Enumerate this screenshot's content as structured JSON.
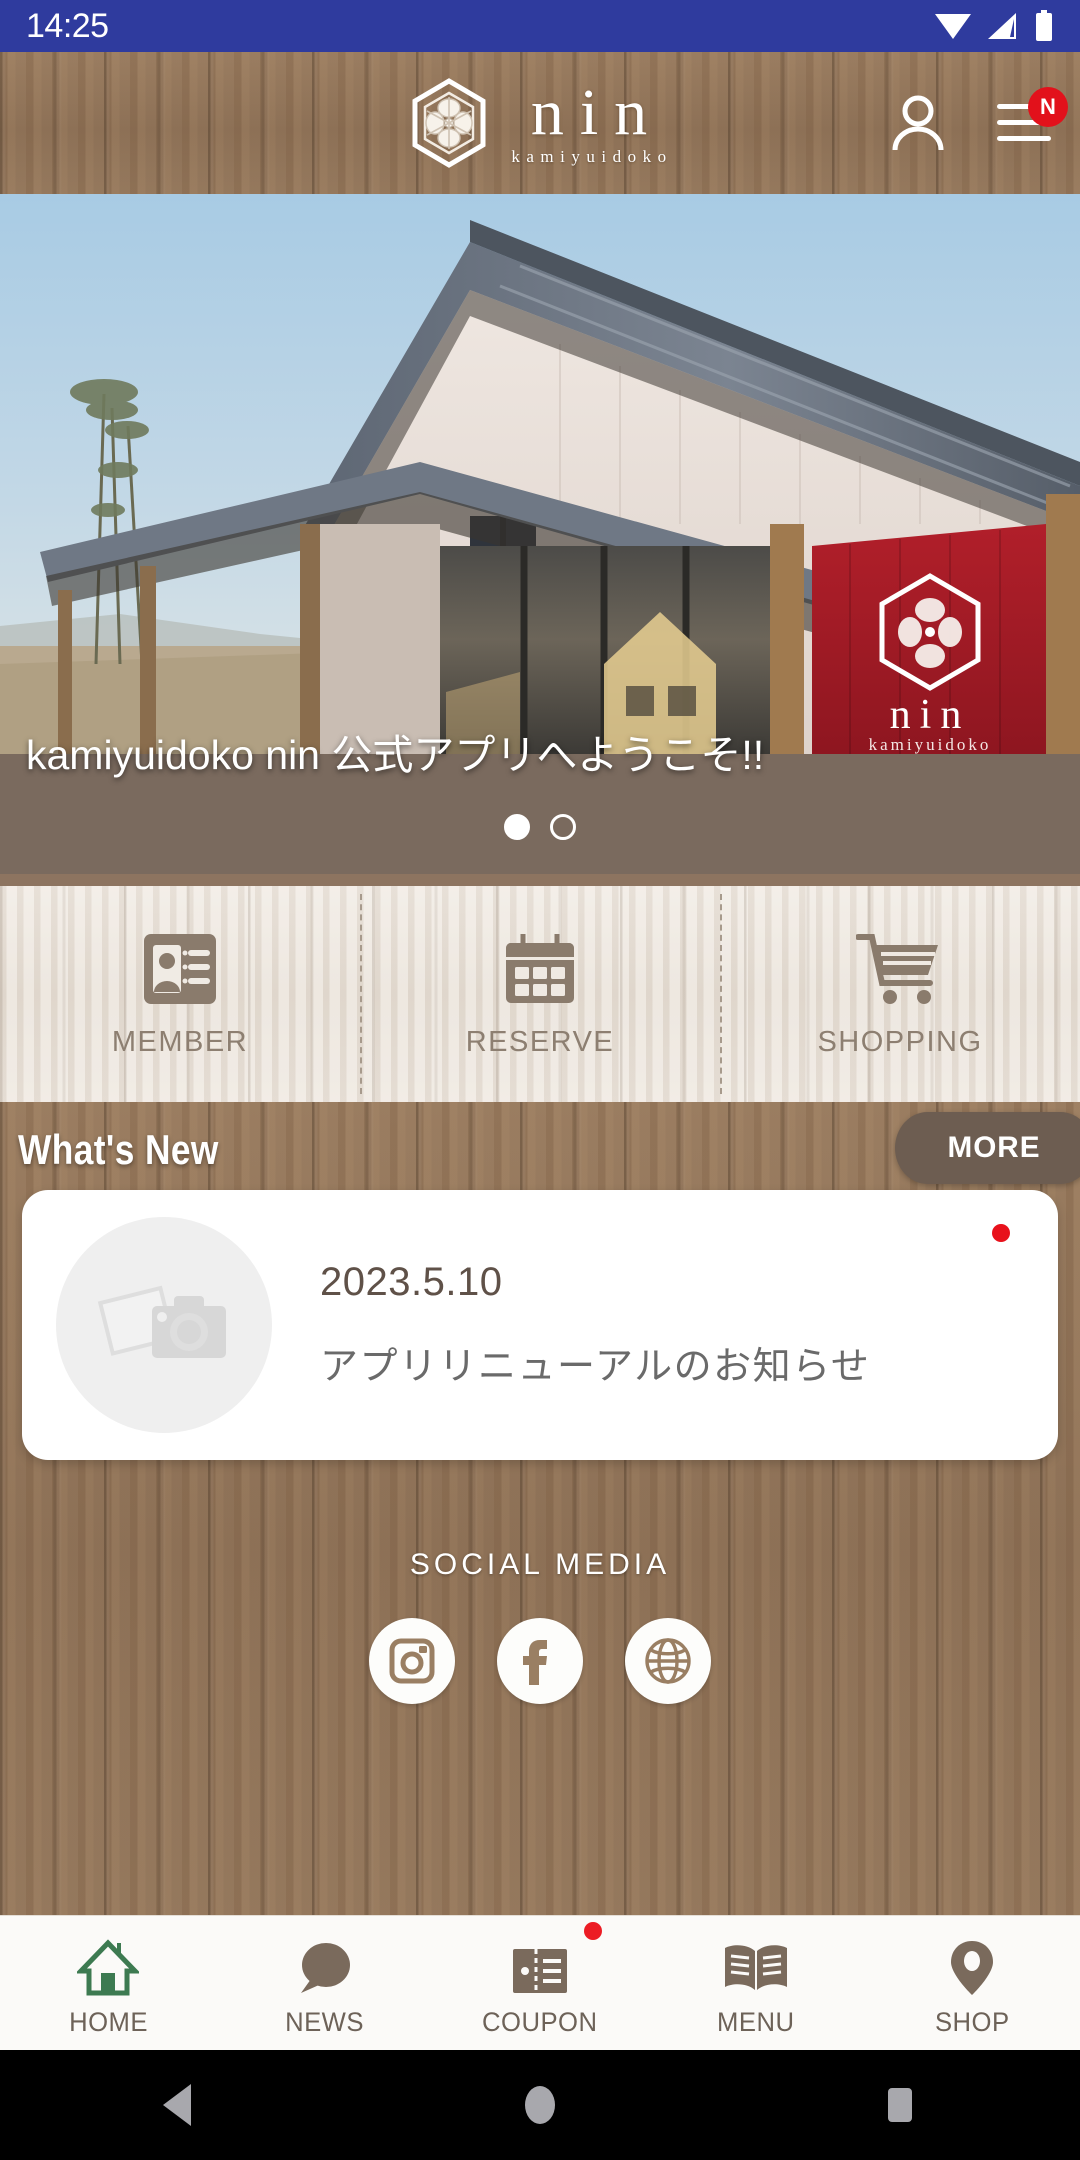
{
  "status_bar": {
    "time": "14:25",
    "icons": [
      "wifi-icon",
      "cellular-signal-icon",
      "battery-icon"
    ]
  },
  "header": {
    "logo_word": "nin",
    "logo_sub": "kamiyuidoko",
    "logo_mark_icon": "hexagon-blossom-logo-icon",
    "account_icon": "person-icon",
    "menu_icon": "hamburger-menu-icon",
    "menu_badge": "N",
    "badge_color": "#e2111b"
  },
  "hero": {
    "caption": "kamiyuidoko nin 公式アプリへようこそ!!",
    "slide_count": 2,
    "active_slide": 1,
    "banner_word": "nin",
    "banner_sub": "kamiyuidoko",
    "photo_alt": "storefront-photo"
  },
  "quick_actions": [
    {
      "label": "MEMBER",
      "icon": "id-card-icon"
    },
    {
      "label": "RESERVE",
      "icon": "calendar-icon"
    },
    {
      "label": "SHOPPING",
      "icon": "shopping-cart-icon"
    }
  ],
  "whats_new": {
    "title": "What's New",
    "more_label": "MORE",
    "items": [
      {
        "date": "2023.5.10",
        "headline": "アプリリニューアルのお知らせ",
        "thumb_icon": "photo-camera-placeholder-icon",
        "unread": true
      }
    ]
  },
  "social": {
    "label": "SOCIAL MEDIA",
    "links": [
      {
        "name": "instagram-icon"
      },
      {
        "name": "facebook-icon"
      },
      {
        "name": "website-globe-icon"
      }
    ]
  },
  "bottom_nav": {
    "active": "HOME",
    "active_color": "#3d7a51",
    "inactive_color": "#7a6a5c",
    "items": [
      {
        "label": "HOME",
        "icon": "home-icon",
        "badge": false
      },
      {
        "label": "NEWS",
        "icon": "speech-bubble-icon",
        "badge": false
      },
      {
        "label": "COUPON",
        "icon": "ticket-icon",
        "badge": true
      },
      {
        "label": "MENU",
        "icon": "open-book-icon",
        "badge": false
      },
      {
        "label": "SHOP",
        "icon": "map-pin-icon",
        "badge": false
      }
    ]
  },
  "android_nav": {
    "back": "back-triangle-icon",
    "home": "home-circle-icon",
    "recents": "recents-square-icon"
  },
  "colors": {
    "status_bar": "#2f3b9e",
    "wood_dark": "#95795f",
    "wood_light": "#efe9e2",
    "accent_red": "#e2111b",
    "brown_text": "#6d5d51"
  }
}
